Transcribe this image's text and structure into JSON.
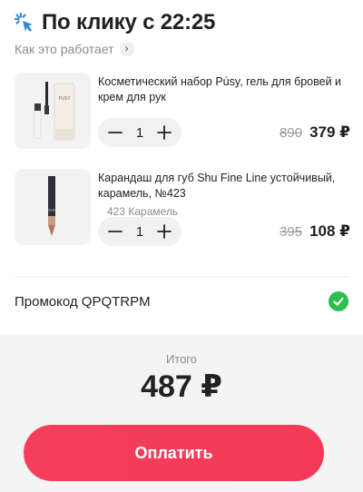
{
  "header": {
    "title": "По клику с 22:25",
    "howto_label": "Как это работает",
    "icon": "sparkle-click-icon",
    "accent_color": "#2f8cd6"
  },
  "cart": {
    "items": [
      {
        "name": "Косметический набор Púsy, гель для бровей и крем для рук",
        "variant": "",
        "quantity": "1",
        "old_price": "890",
        "price": "379 ₽"
      },
      {
        "name": "Карандаш для губ Shu Fine Line устойчивый, карамель, №423",
        "variant": "423 Карамель",
        "quantity": "1",
        "old_price": "395",
        "price": "108 ₽"
      }
    ]
  },
  "promo": {
    "label": "Промокод QPQTRPM",
    "status_icon": "check-icon",
    "status_color": "#2ebd4f"
  },
  "footer": {
    "total_label": "Итого",
    "total_value": "487 ₽",
    "pay_label": "Оплатить",
    "pay_color": "#f43f5e"
  }
}
